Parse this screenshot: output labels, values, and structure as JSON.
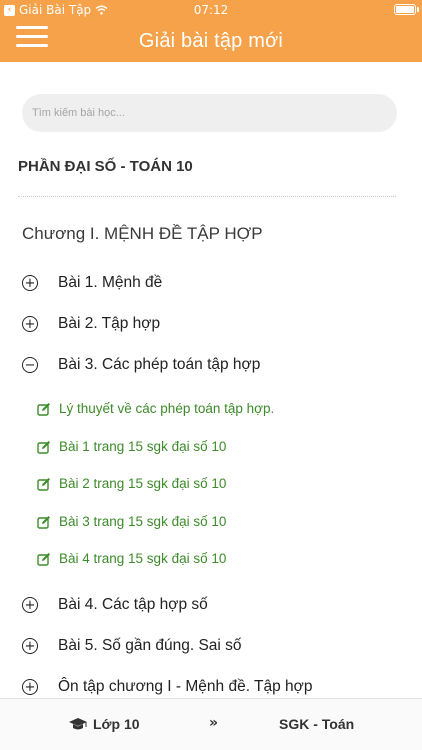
{
  "status_bar": {
    "back_app": "Giải Bài Tập",
    "time": "07:12"
  },
  "nav": {
    "title": "Giải bài tập mới"
  },
  "search": {
    "placeholder": "Tìm kiếm bài học..."
  },
  "section": {
    "title": "PHẦN ĐẠI SỐ - TOÁN 10"
  },
  "chapter": {
    "title": "Chương I. MỆNH ĐỀ TẬP HỢP"
  },
  "lessons": [
    {
      "label": "Bài 1. Mệnh đề",
      "toggle": "+"
    },
    {
      "label": "Bài 2. Tập hợp",
      "toggle": "+"
    },
    {
      "label": "Bài 3. Các phép toán tập hợp",
      "toggle": "−"
    },
    {
      "label": "Bài 4. Các tập hợp số",
      "toggle": "+"
    },
    {
      "label": "Bài 5. Số gần đúng. Sai số",
      "toggle": "+"
    },
    {
      "label": "Ôn tập chương I - Mệnh đề. Tập hợp",
      "toggle": "+"
    }
  ],
  "sub_items": [
    {
      "label": "Lý thuyết về các phép toán tập hợp."
    },
    {
      "label": "Bài 1 trang 15 sgk đại số 10"
    },
    {
      "label": "Bài 2 trang 15 sgk đại số 10"
    },
    {
      "label": "Bài 3 trang 15 sgk đại số 10"
    },
    {
      "label": "Bài 4 trang 15 sgk đại số 10"
    }
  ],
  "tab_bar": {
    "grade": "Lớp 10",
    "separator": "»",
    "subject": "SGK - Toán"
  },
  "colors": {
    "header": "#f5a24a",
    "sub_item_green": "#3d8b2a",
    "search_bg": "#efefef"
  },
  "icons": {
    "menu": "hamburger-icon",
    "expand": "plus-circle-icon",
    "collapse": "minus-circle-icon",
    "sub_item": "edit-icon",
    "grade": "graduation-cap-icon"
  }
}
